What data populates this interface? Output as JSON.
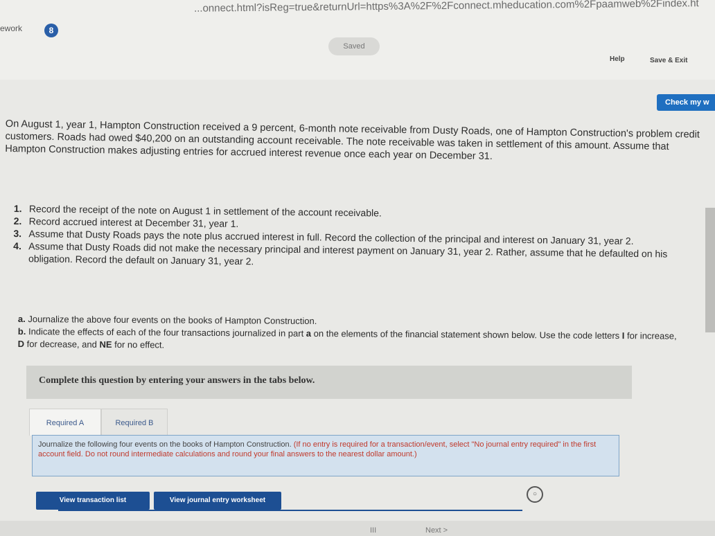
{
  "browser": {
    "url": "...onnect.html?isReg=true&returnUrl=https%3A%2F%2Fconnect.mheducation.com%2Fpaamweb%2Findex.ht"
  },
  "header": {
    "tab_name": "ework",
    "badge": "8",
    "saved_label": "Saved",
    "help_label": "Help",
    "save_exit_label": "Save & Exit",
    "check_label": "Check my w"
  },
  "problem": {
    "intro": "On August 1, year 1, Hampton Construction received a 9 percent, 6-month note receivable from Dusty Roads, one of Hampton Construction's problem credit customers. Roads had owed $40,200 on an outstanding account receivable. The note receivable was taken in settlement of this amount. Assume that Hampton Construction makes adjusting entries for accrued interest revenue once each year on December 31.",
    "steps": [
      {
        "num": "1.",
        "text": "Record the receipt of the note on August 1 in settlement of the account receivable."
      },
      {
        "num": "2.",
        "text": "Record accrued interest at December 31, year 1."
      },
      {
        "num": "3.",
        "text": "Assume that Dusty Roads pays the note plus accrued interest in full. Record the collection of the principal and interest on January 31, year 2."
      },
      {
        "num": "4.",
        "text": "Assume that Dusty Roads did not make the necessary principal and interest payment on January 31, year 2. Rather, assume that he defaulted on his obligation. Record the default on January 31, year 2."
      }
    ],
    "part_a_letter": "a.",
    "part_a": "Journalize the above four events on the books of Hampton Construction.",
    "part_b_letter": "b.",
    "part_b_1": "Indicate the effects of each of the four transactions journalized in part ",
    "part_b_bold": "a",
    "part_b_2": " on the elements of the financial statement shown below. Use the code letters ",
    "code_i": "I",
    "part_b_3": " for increase, ",
    "code_d": "D",
    "part_b_4": " for decrease, and ",
    "code_ne": "NE",
    "part_b_5": " for no effect."
  },
  "complete_banner": "Complete this question by entering your answers in the tabs below.",
  "tabs": [
    {
      "label": "Required A"
    },
    {
      "label": "Required B"
    }
  ],
  "instructions": {
    "main": "Journalize the following four events on the books of Hampton Construction.",
    "note": " (If no entry is required for a transaction/event, select \"No journal entry required\" in the first account field. Do not round intermediate calculations and round your final answers to the nearest dollar amount.)"
  },
  "buttons": {
    "view_transaction_list": "View transaction list",
    "view_journal_worksheet": "View journal entry worksheet"
  },
  "footer": {
    "page": "III",
    "next_label": "Next >"
  }
}
